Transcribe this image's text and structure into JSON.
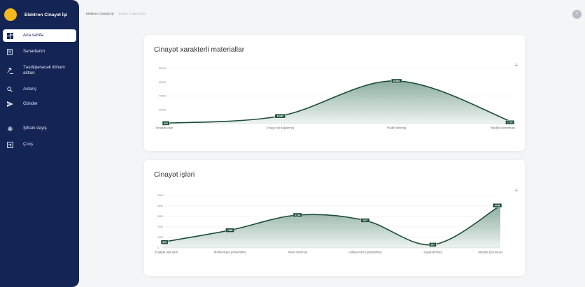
{
  "app": {
    "title": "Elektron Cinayət İşi"
  },
  "sidebar": {
    "items": [
      {
        "label": "Ana səhifə",
        "icon": "dashboard-icon"
      },
      {
        "label": "Sənədlərim",
        "icon": "document-icon"
      },
      {
        "label": "Təsdiqlənəcək ittiham aktları",
        "icon": "gavel-icon"
      },
      {
        "label": "Axtarış",
        "icon": "search-icon"
      },
      {
        "label": "Göndər",
        "icon": "send-icon"
      },
      {
        "label": "Şifrəni dəyiş",
        "icon": "gear-icon"
      },
      {
        "label": "Çıxış",
        "icon": "logout-icon"
      }
    ]
  },
  "topbar": {
    "breadcrumb": "Elektron Cinayət İşi",
    "date": "Cümə, 3 İyun 2022",
    "avatar_letter": "T"
  },
  "cards": [
    {
      "title": "Cinayət xarakterli materiallar"
    },
    {
      "title": "Cinayət işləri"
    }
  ],
  "colors": {
    "sidebar": "#142455",
    "accent": "#2e6b52",
    "logo": "#f5b91e"
  },
  "chart_data": [
    {
      "type": "area",
      "title": "Cinayət xarakterli materiallar",
      "categories": [
        "İcraatda olan",
        "Cinayət işi başlanmış",
        "Rədd olunmuş",
        "Müddət pozuntusu"
      ],
      "values": [
        554,
        10945,
        61884,
        1778
      ],
      "data_labels": [
        "554",
        "10945",
        "61884",
        "1778"
      ],
      "yticks": [
        "80000",
        "60000",
        "40000",
        "20000"
      ],
      "ylim": [
        0,
        80000
      ],
      "smooth": true
    },
    {
      "type": "area",
      "title": "Cinayət işləri",
      "categories": [
        "İcraatda olan işlər",
        "Məhkəməyə göndərilmiş",
        "Xitam olunmuş",
        "Aidiyyəti üzrə göndərilmiş",
        "Dayandırılmış",
        "Müddət pozuntusu"
      ],
      "values": [
        555,
        1686,
        3134,
        2627,
        307,
        4048
      ],
      "data_labels": [
        "555",
        "1686",
        "3134",
        "2627",
        "307",
        "4048"
      ],
      "yticks": [
        "5000",
        "4000",
        "3000",
        "2000",
        "1000",
        "0"
      ],
      "ylim": [
        0,
        5000
      ],
      "smooth": true
    }
  ]
}
